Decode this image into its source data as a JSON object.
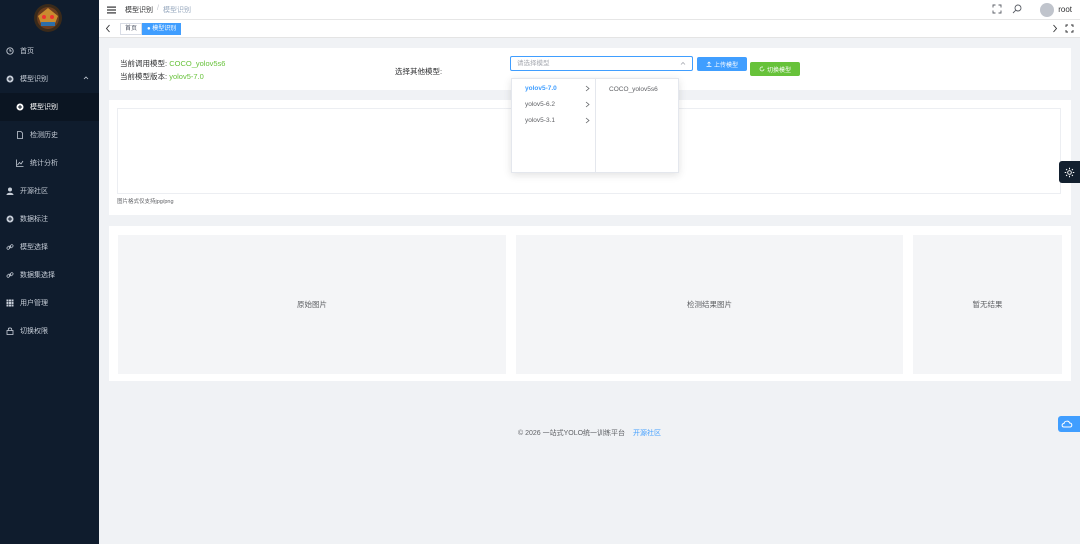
{
  "header": {
    "breadcrumb": [
      "模型识别",
      "模型识别"
    ],
    "user": "root"
  },
  "sidebar": {
    "items": [
      {
        "label": "首页",
        "icon": "home-icon"
      },
      {
        "label": "模型识别",
        "icon": "plus-circle-icon"
      },
      {
        "label": "模型识别",
        "icon": "plus-circle-icon"
      },
      {
        "label": "检测历史",
        "icon": "document-icon"
      },
      {
        "label": "统计分析",
        "icon": "chart-icon"
      },
      {
        "label": "开源社区",
        "icon": "user-icon"
      },
      {
        "label": "数据标注",
        "icon": "plus-circle-icon"
      },
      {
        "label": "模型选择",
        "icon": "link-icon"
      },
      {
        "label": "数据集选择",
        "icon": "link-icon"
      },
      {
        "label": "用户管理",
        "icon": "grid-icon"
      },
      {
        "label": "切换权限",
        "icon": "lock-icon"
      }
    ]
  },
  "tags": {
    "home": "首页",
    "current": "● 模型识别"
  },
  "model": {
    "current_label": "当前调用模型:",
    "current_value": "COCO_yolov5s6",
    "version_label": "当前模型版本:",
    "version_value": "yolov5-7.0",
    "select_label": "选择其他模型:",
    "select_placeholder": "请选择模型",
    "upload_btn": "上传模型",
    "switch_btn": "切换模型"
  },
  "cascader": {
    "versions": [
      "yolov5-7.0",
      "yolov5-6.2",
      "yolov5-3.1"
    ],
    "models": [
      "COCO_yolov5s6"
    ]
  },
  "upload": {
    "hint": "图片格式仅支持jpg/png"
  },
  "panels": {
    "original": "原始图片",
    "detected": "检测结果图片",
    "result": "暂无结果"
  },
  "footer": {
    "text": "© 2026 一站式YOLO统一训练平台",
    "link": "开源社区"
  },
  "colors": {
    "sidebar_bg": "#0f1c2d",
    "primary": "#409eff",
    "success": "#67c23a"
  }
}
